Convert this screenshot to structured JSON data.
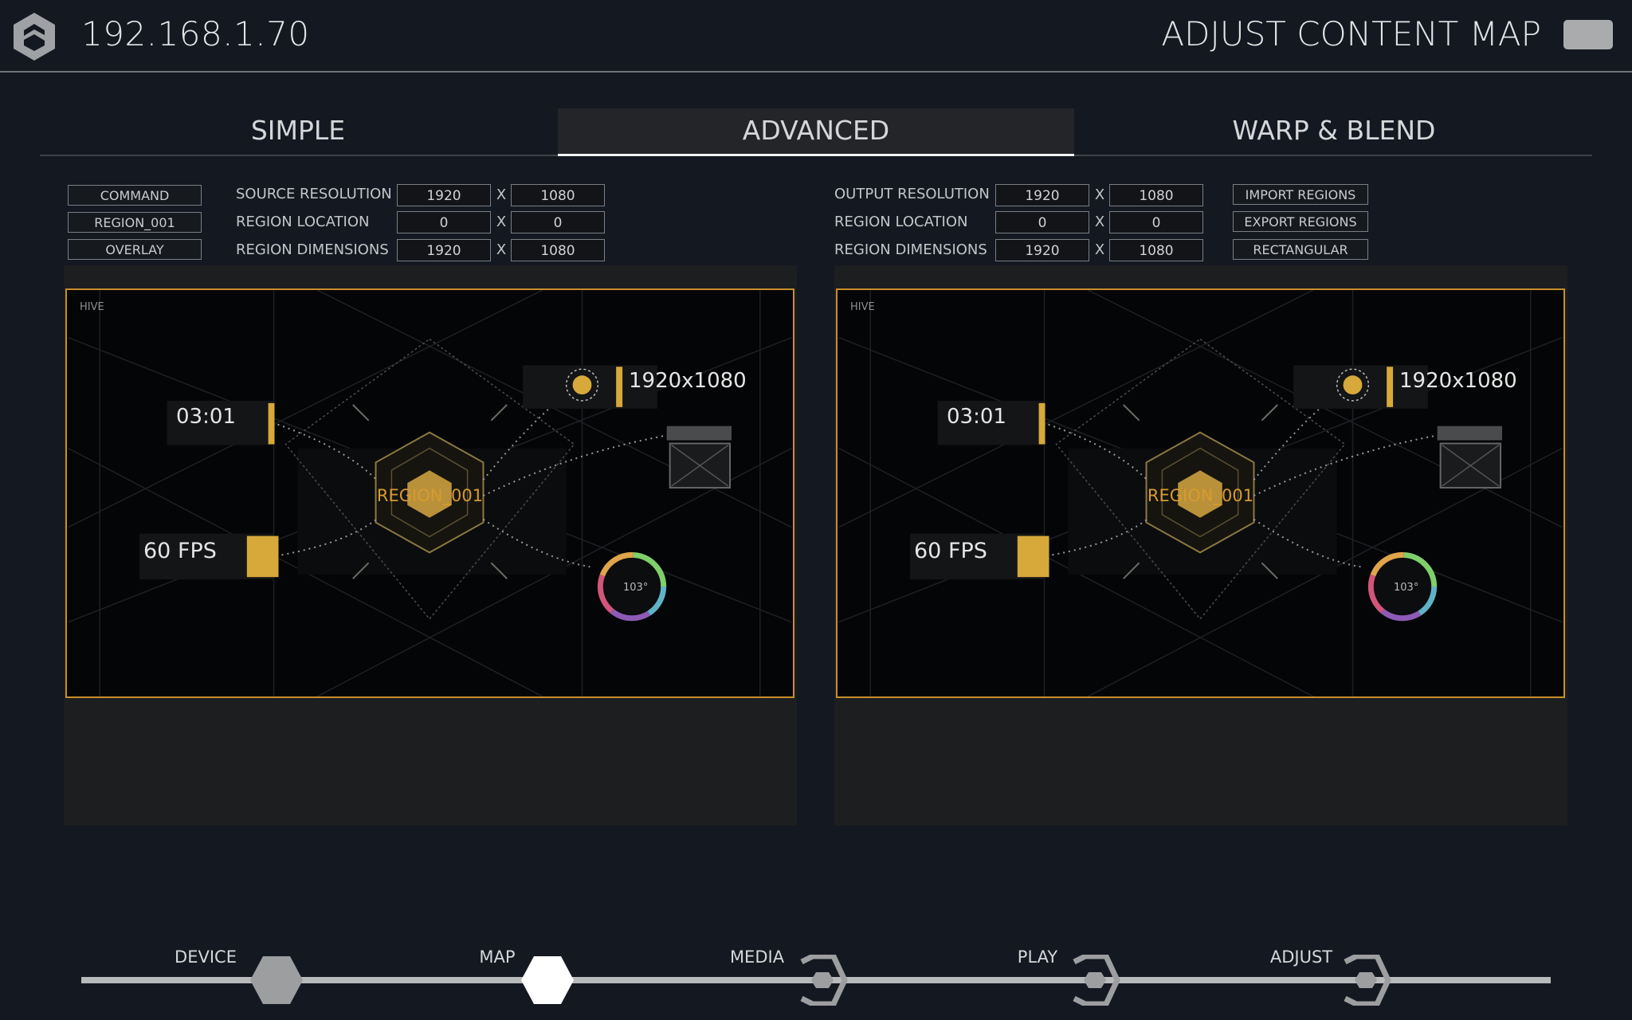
{
  "header": {
    "ip": "192.168.1.70",
    "title": "ADJUST CONTENT MAP"
  },
  "tabs": [
    {
      "label": "SIMPLE",
      "active": false
    },
    {
      "label": "ADVANCED",
      "active": true
    },
    {
      "label": "WARP & BLEND",
      "active": false
    }
  ],
  "left": {
    "buttons": [
      "COMMAND",
      "REGION_001",
      "OVERLAY"
    ],
    "rows": [
      {
        "label": "SOURCE RESOLUTION",
        "a": "1920",
        "b": "1080"
      },
      {
        "label": "REGION LOCATION",
        "a": "0",
        "b": "0"
      },
      {
        "label": "REGION DIMENSIONS",
        "a": "1920",
        "b": "1080"
      }
    ]
  },
  "right": {
    "rows": [
      {
        "label": "OUTPUT RESOLUTION",
        "a": "1920",
        "b": "1080"
      },
      {
        "label": "REGION LOCATION",
        "a": "0",
        "b": "0"
      },
      {
        "label": "REGION DIMENSIONS",
        "a": "1920",
        "b": "1080"
      }
    ],
    "buttons": [
      "IMPORT REGIONS",
      "EXPORT REGIONS",
      "RECTANGULAR"
    ]
  },
  "separator": "X",
  "preview": {
    "region_label": "REGION_001",
    "corner": "HIVE",
    "resolution": "1920x1080",
    "time": "03:01",
    "fps": "60 FPS",
    "angle": "103°"
  },
  "timeline": {
    "steps": [
      "DEVICE",
      "MAP",
      "MEDIA",
      "PLAY",
      "ADJUST"
    ],
    "current_step": "MAP"
  },
  "colors": {
    "accent": "#c78f2a",
    "gold": "#d6a93a",
    "background": "#141820"
  }
}
